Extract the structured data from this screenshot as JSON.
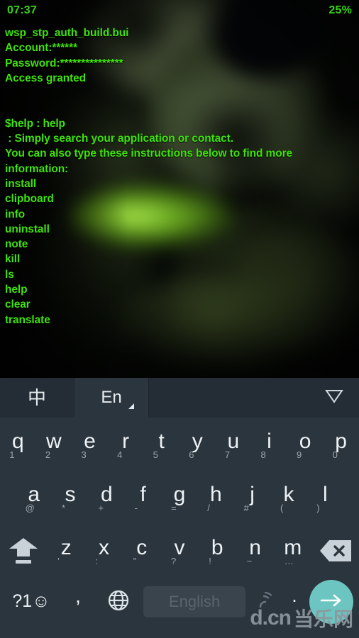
{
  "status_bar": {
    "time": "07:37",
    "battery": "25%",
    "text_color": "#35d412"
  },
  "console": {
    "text_color": "#3ee20a",
    "lines": [
      "wsp_stp_auth_build.bui",
      "Account:******",
      "Password:***************",
      "Access granted",
      "",
      "$help : help",
      " : Simply search your application or contact.",
      "You can also type these instructions below to find more",
      "information:",
      "install",
      "clipboard",
      "info",
      "uninstall",
      "note",
      "kill",
      "ls",
      "help",
      "clear",
      "translate"
    ]
  },
  "keyboard": {
    "background_color": "#2b353d",
    "toolbar": {
      "chinese_tab": "中",
      "english_tab": "En",
      "collapse_icon": "chevron-down-icon"
    },
    "row1": [
      {
        "letter": "q",
        "sub": "1"
      },
      {
        "letter": "w",
        "sub": "2"
      },
      {
        "letter": "e",
        "sub": "3"
      },
      {
        "letter": "r",
        "sub": "4"
      },
      {
        "letter": "t",
        "sub": "5"
      },
      {
        "letter": "y",
        "sub": "6"
      },
      {
        "letter": "u",
        "sub": "7"
      },
      {
        "letter": "i",
        "sub": "8"
      },
      {
        "letter": "o",
        "sub": "9"
      },
      {
        "letter": "p",
        "sub": "0"
      }
    ],
    "row2": [
      {
        "letter": "a",
        "sub": "@"
      },
      {
        "letter": "s",
        "sub": "*"
      },
      {
        "letter": "d",
        "sub": "+"
      },
      {
        "letter": "f",
        "sub": "-"
      },
      {
        "letter": "g",
        "sub": "="
      },
      {
        "letter": "h",
        "sub": "/"
      },
      {
        "letter": "j",
        "sub": "#"
      },
      {
        "letter": "k",
        "sub": "("
      },
      {
        "letter": "l",
        "sub": ")"
      }
    ],
    "row3": [
      {
        "letter": "z",
        "sub": "'"
      },
      {
        "letter": "x",
        "sub": ":"
      },
      {
        "letter": "c",
        "sub": "\""
      },
      {
        "letter": "v",
        "sub": "?"
      },
      {
        "letter": "b",
        "sub": "!"
      },
      {
        "letter": "n",
        "sub": "~"
      },
      {
        "letter": "m",
        "sub": "…"
      }
    ],
    "shift_icon": "shift-arrow-icon",
    "backspace_icon": "backspace-icon",
    "bottom_row": {
      "symbol_key": "?1☺",
      "comma_key": ",",
      "globe_icon": "globe-icon",
      "space_label": "English",
      "mic_icon": "voice-input-icon",
      "period_key": ".",
      "enter_icon": "arrow-right-icon",
      "enter_color": "#6cc5c0"
    }
  },
  "watermark": {
    "latin": "d.cn",
    "chinese": "当乐网"
  }
}
